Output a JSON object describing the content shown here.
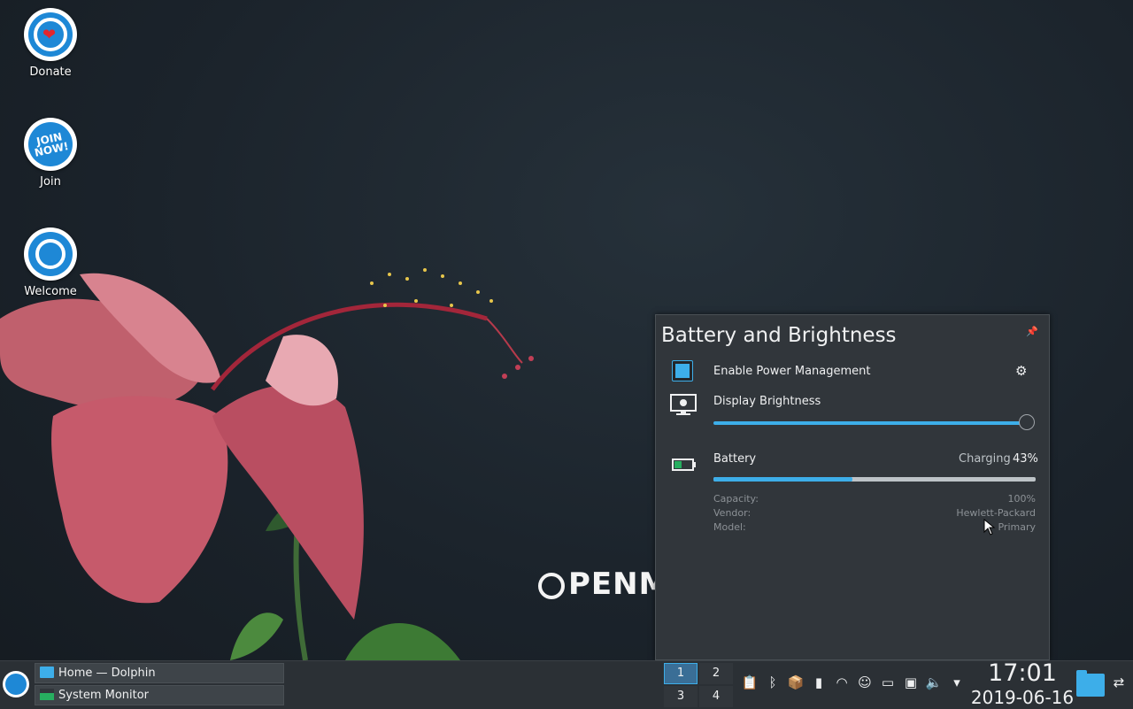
{
  "desktop": {
    "icons": [
      {
        "label": "Donate",
        "icon": "donate-heart-icon"
      },
      {
        "label": "Join",
        "icon": "join-now-icon",
        "badge_text": "JOIN NOW!"
      },
      {
        "label": "Welcome",
        "icon": "openmandriva-icon"
      }
    ],
    "wallpaper_logo": "PENMA"
  },
  "popup": {
    "title": "Battery and Brightness",
    "power_management": {
      "label": "Enable Power Management",
      "checked": true
    },
    "brightness": {
      "label": "Display Brightness",
      "level": 1.0
    },
    "battery": {
      "label": "Battery",
      "status": "Charging",
      "percent": "43%",
      "charge_level": 0.43,
      "details": [
        {
          "key": "Capacity:",
          "value": "100%"
        },
        {
          "key": "Vendor:",
          "value": "Hewlett-Packard"
        },
        {
          "key": "Model:",
          "value": "Primary"
        }
      ]
    }
  },
  "taskbar": {
    "tasks": [
      {
        "label": "Home — Dolphin",
        "icon": "folder-icon"
      },
      {
        "label": "System Monitor",
        "icon": "system-monitor-icon"
      }
    ],
    "pager": [
      "1",
      "2",
      "3",
      "4"
    ],
    "active_desktop": "1",
    "clock": {
      "time": "17:01",
      "date": "2019-06-16"
    }
  },
  "colors": {
    "accent": "#3daee9",
    "panel": "#31363b",
    "taskbar": "#2b3035"
  }
}
